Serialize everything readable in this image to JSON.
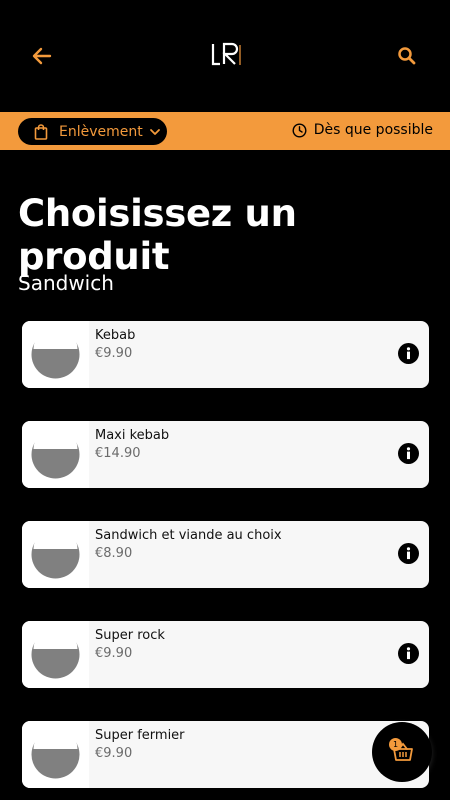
{
  "header": {
    "logo_text": "LR"
  },
  "order_bar": {
    "mode_label": "Enlèvement",
    "time_label": "Dès que possible"
  },
  "page_title": "Choisissez un produit",
  "section": {
    "title": "Sandwich"
  },
  "products": [
    {
      "name": "Kebab",
      "price": "€9.90"
    },
    {
      "name": "Maxi kebab",
      "price": "€14.90"
    },
    {
      "name": "Sandwich et viande au choix",
      "price": "€8.90"
    },
    {
      "name": "Super rock",
      "price": "€9.90"
    },
    {
      "name": "Super fermier",
      "price": "€9.90"
    }
  ],
  "cart": {
    "count": "1"
  },
  "colors": {
    "accent": "#f39a3c",
    "background": "#000000",
    "card": "#f7f7f7",
    "placeholder": "#808080"
  },
  "icons": [
    "back-arrow-icon",
    "search-icon",
    "shopping-bag-icon",
    "chevron-down-icon",
    "clock-icon",
    "info-icon",
    "basket-icon"
  ]
}
